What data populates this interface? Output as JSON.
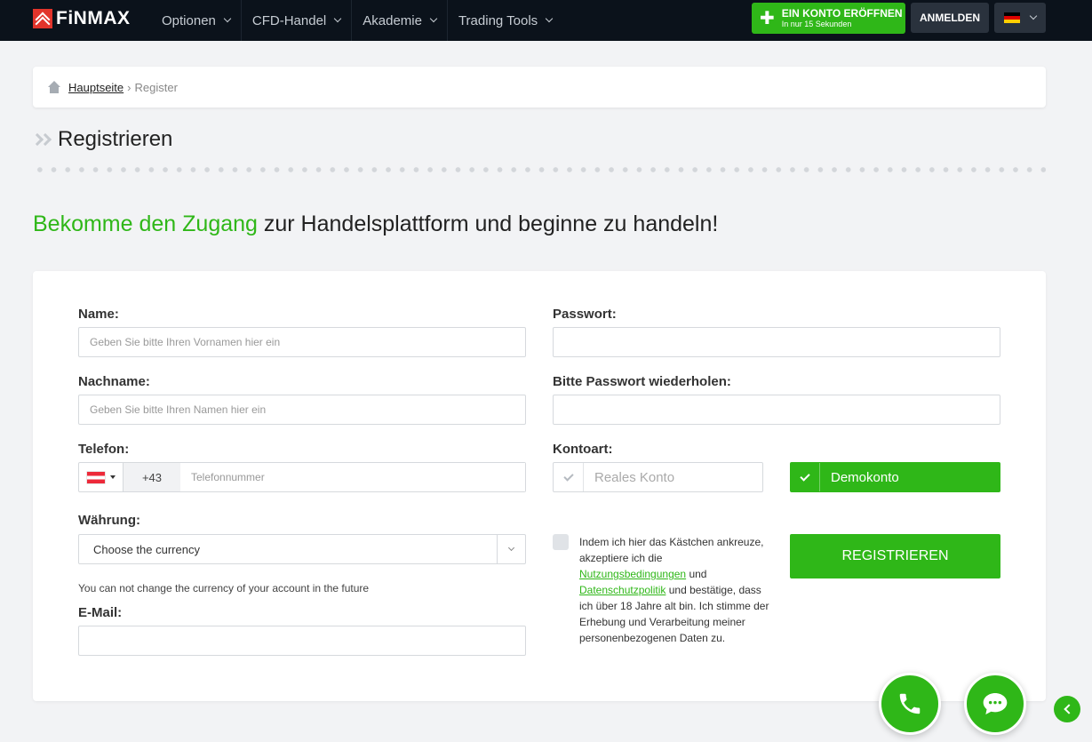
{
  "brand": {
    "name": "FiNMAX"
  },
  "nav": {
    "items": [
      {
        "label": "Optionen"
      },
      {
        "label": "CFD-Handel"
      },
      {
        "label": "Akademie"
      },
      {
        "label": "Trading Tools"
      }
    ]
  },
  "header": {
    "open_account_label": "EIN KONTO ERÖFFNEN",
    "open_account_sub": "In nur 15 Sekunden",
    "login_label": "ANMELDEN",
    "language": "de"
  },
  "breadcrumb": {
    "home": "Hauptseite",
    "separator": "›",
    "current": "Register"
  },
  "page": {
    "title": "Registrieren",
    "headline_highlight": "Bekomme den Zugang",
    "headline_rest": " zur Handelsplattform und beginne zu handeln!"
  },
  "form": {
    "name_label": "Name:",
    "name_placeholder": "Geben Sie bitte Ihren Vornamen hier ein",
    "lastname_label": "Nachname:",
    "lastname_placeholder": "Geben Sie bitte Ihren Namen hier ein",
    "phone_label": "Telefon:",
    "phone_code": "+43",
    "phone_placeholder": "Telefonnummer",
    "currency_label": "Währung:",
    "currency_value": "Choose the currency",
    "currency_note": "You can not change the currency of your account in the future",
    "email_label": "E-Mail:",
    "password_label": "Passwort:",
    "password_repeat_label": "Bitte Passwort wiederholen:",
    "account_type_label": "Kontoart:",
    "account_real": "Reales Konto",
    "account_demo": "Demokonto",
    "account_selected": "Demokonto",
    "terms_part1": "Indem ich hier das Kästchen ankreuze, akzeptiere ich die ",
    "terms_link1": "Nutzungsbedingungen",
    "terms_part2": " und ",
    "terms_link2": "Datenschutzpolitik",
    "terms_part3": " und bestätige, dass ich über 18 Jahre alt bin. Ich stimme der Erhebung und Verarbeitung meiner personenbezogenen Daten zu.",
    "submit_label": "REGISTRIEREN"
  },
  "colors": {
    "accent": "#2fb718",
    "topbar": "#0b121b",
    "background": "#f2f3f5"
  }
}
